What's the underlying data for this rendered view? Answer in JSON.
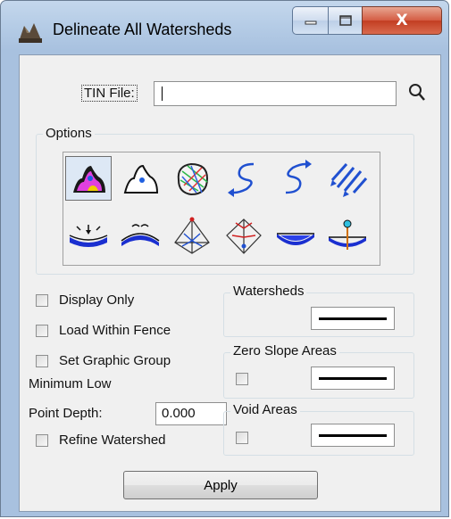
{
  "window": {
    "title": "Delineate All Watersheds",
    "icon": "watershed-app-icon",
    "controls": {
      "minimize": "minimize-icon",
      "maximize": "maximize-icon",
      "close_label": "X"
    }
  },
  "tin": {
    "label": "TIN File:",
    "value": "",
    "browse_icon": "magnifier-icon"
  },
  "options": {
    "legend": "Options",
    "tools": [
      {
        "icon": "delineate-all-watersheds-icon",
        "selected": true
      },
      {
        "icon": "delineate-watershed-icon",
        "selected": false
      },
      {
        "icon": "contour-watershed-icon",
        "selected": false
      },
      {
        "icon": "trace-flow-path-icon",
        "selected": false
      },
      {
        "icon": "trace-upstream-icon",
        "selected": false
      },
      {
        "icon": "flow-arrows-icon",
        "selected": false
      },
      {
        "icon": "low-point-icon",
        "selected": false
      },
      {
        "icon": "high-point-icon",
        "selected": false
      },
      {
        "icon": "ridge-lines-icon",
        "selected": false
      },
      {
        "icon": "drainage-lines-icon",
        "selected": false
      },
      {
        "icon": "pond-icon",
        "selected": false
      },
      {
        "icon": "drain-depth-icon",
        "selected": false
      }
    ]
  },
  "checks": {
    "display_only": {
      "label": "Display Only",
      "checked": false
    },
    "load_within_fence": {
      "label": "Load Within Fence",
      "checked": false
    },
    "set_graphic_group": {
      "label": "Set Graphic Group",
      "checked": false
    },
    "refine_watershed": {
      "label": "Refine Watershed",
      "checked": false
    }
  },
  "minimum_low": {
    "label_line1": "Minimum Low",
    "label_line2": "Point Depth:",
    "value": "0.000"
  },
  "groups": {
    "watersheds": {
      "legend": "Watersheds"
    },
    "zero_slope": {
      "legend": "Zero Slope Areas",
      "checked": false
    },
    "void_areas": {
      "legend": "Void Areas",
      "checked": false
    }
  },
  "apply_label": "Apply",
  "colors": {
    "title_bar": "#b5cce6",
    "client_bg": "#f0f0f0",
    "close_button": "#c23d22"
  }
}
